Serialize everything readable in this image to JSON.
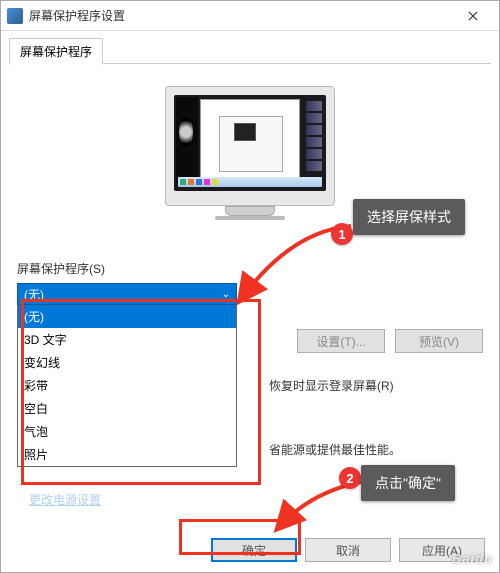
{
  "titlebar": {
    "title": "屏幕保护程序设置"
  },
  "tab": {
    "label": "屏幕保护程序"
  },
  "group": {
    "label": "屏幕保护程序(S)"
  },
  "dropdown": {
    "selected": "(无)",
    "options": [
      "(无)",
      "3D 文字",
      "变幻线",
      "彩带",
      "空白",
      "气泡",
      "照片"
    ]
  },
  "buttons": {
    "settings": "设置(T)...",
    "preview": "预览(V)",
    "ok": "确定",
    "cancel": "取消",
    "apply": "应用(A)"
  },
  "text": {
    "resume": "恢复时显示登录屏幕(R)",
    "power": "省能源或提供最佳性能。"
  },
  "callouts": {
    "c1": "选择屏保样式",
    "c2": "点击\"确定\""
  },
  "badges": {
    "b1": "1",
    "b2": "2"
  },
  "watermark": "Baidu"
}
